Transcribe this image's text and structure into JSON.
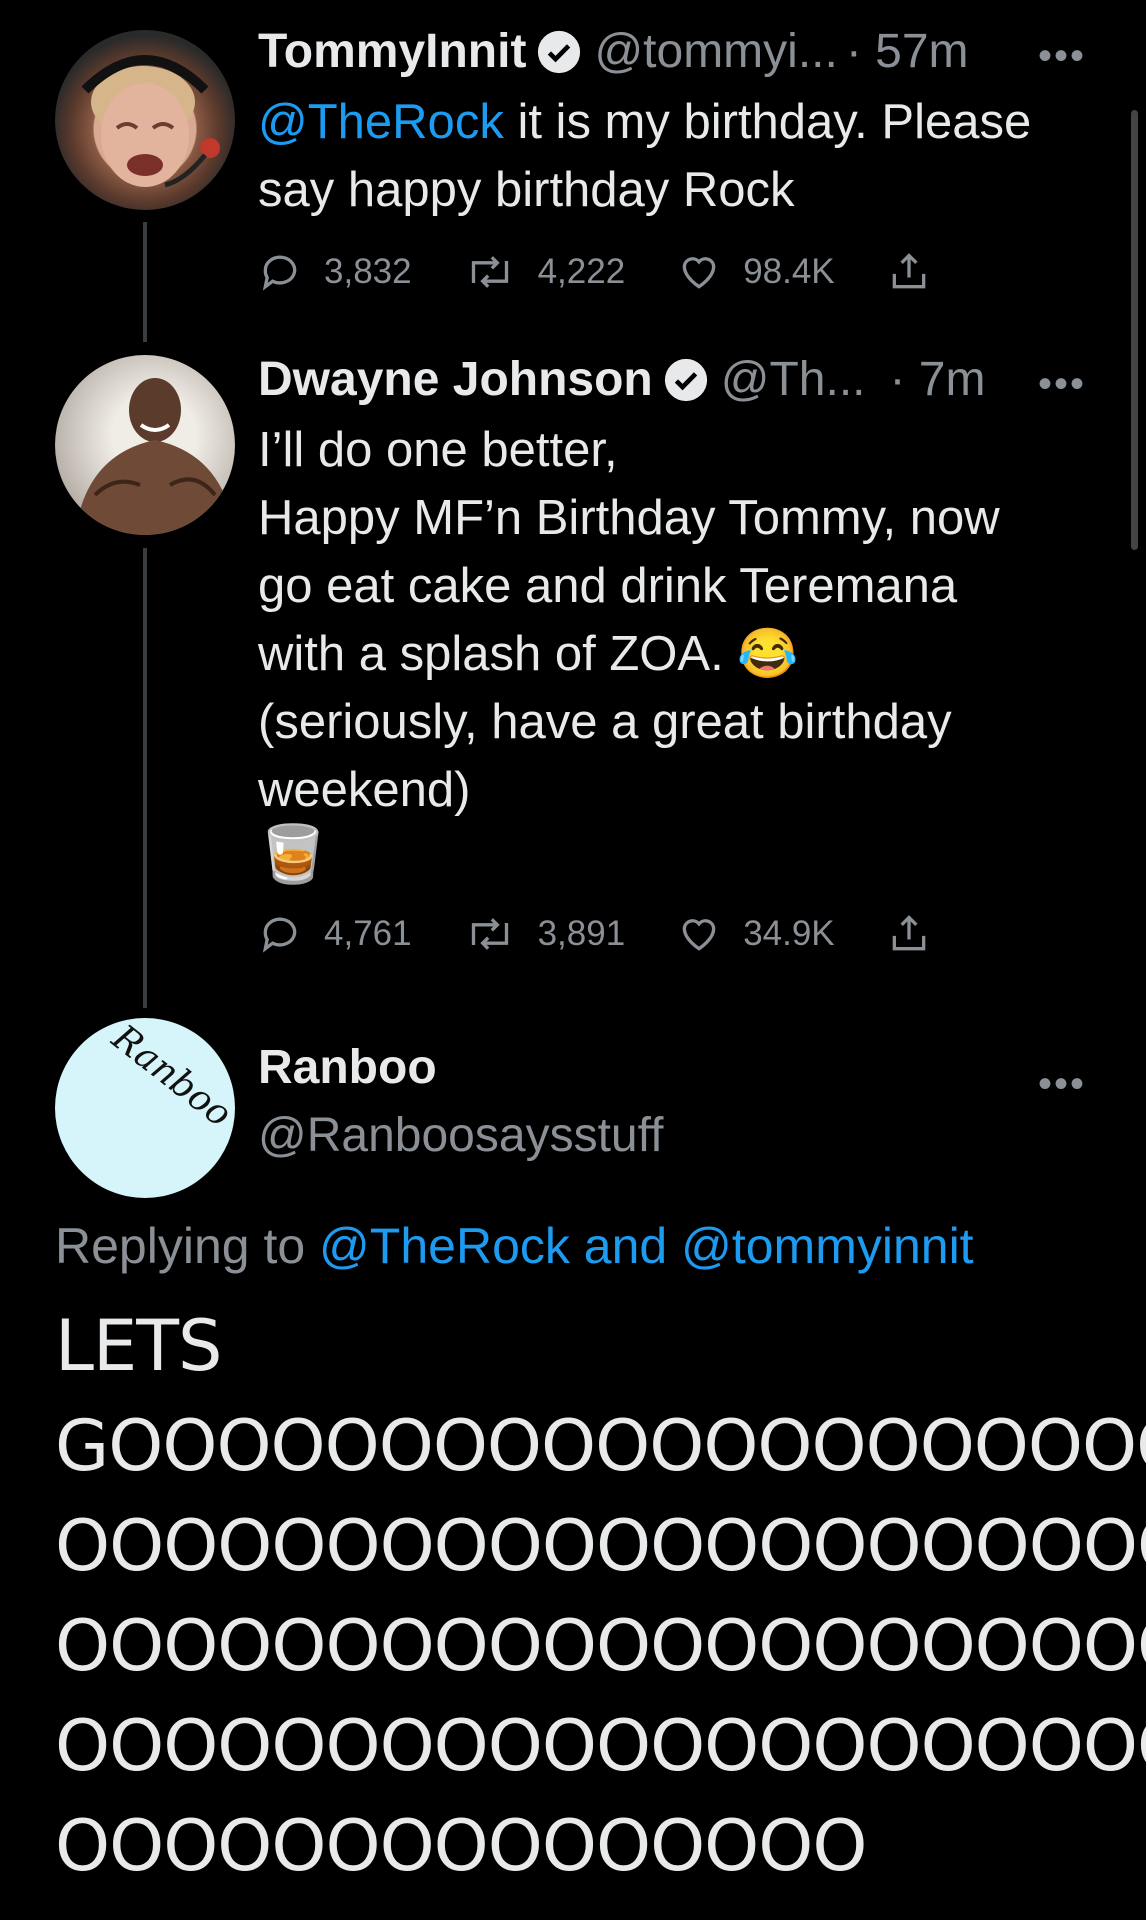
{
  "tweets": [
    {
      "name": "TommyInnit",
      "handle": "@tommyi...",
      "time": "· 57m",
      "mention": "@TheRock",
      "text": " it is my birthday. Please\nsay happy birthday Rock",
      "replies": "3,832",
      "retweets": "4,222",
      "likes": "98.4K"
    },
    {
      "name": "Dwayne Johnson",
      "handle": "@Th...",
      "time": "· 7m",
      "text": "I’ll do one better,\nHappy MF’n Birthday Tommy, now\ngo eat cake and drink Teremana\nwith a splash of ZOA. 😂\n(seriously, have a great birthday\nweekend)",
      "emoji": "🥃",
      "replies": "4,761",
      "retweets": "3,891",
      "likes": "34.9K"
    }
  ],
  "reply": {
    "name": "Ranboo",
    "handle": "@Ranboosaysstuff",
    "avatar_text": "Ranboo",
    "replying_prefix": "Replying to ",
    "replying_links": "@TheRock and @tommyinnit",
    "lines": [
      "LETS",
      "GOOOOOOOOOOOOOOOOOOOO",
      "OOOOOOOOOOOOOOOOOOOOO",
      "OOOOOOOOOOOOOOOOOOOOO",
      "OOOOOOOOOOOOOOOOOOOOO",
      "OOOOOOOOOOOOOOO"
    ]
  },
  "menu_glyph": "•••",
  "colors": {
    "link": "#1d9bf0",
    "muted": "#8b9096",
    "background": "#000000",
    "ranboo_avatar": "#d6f5fa"
  }
}
